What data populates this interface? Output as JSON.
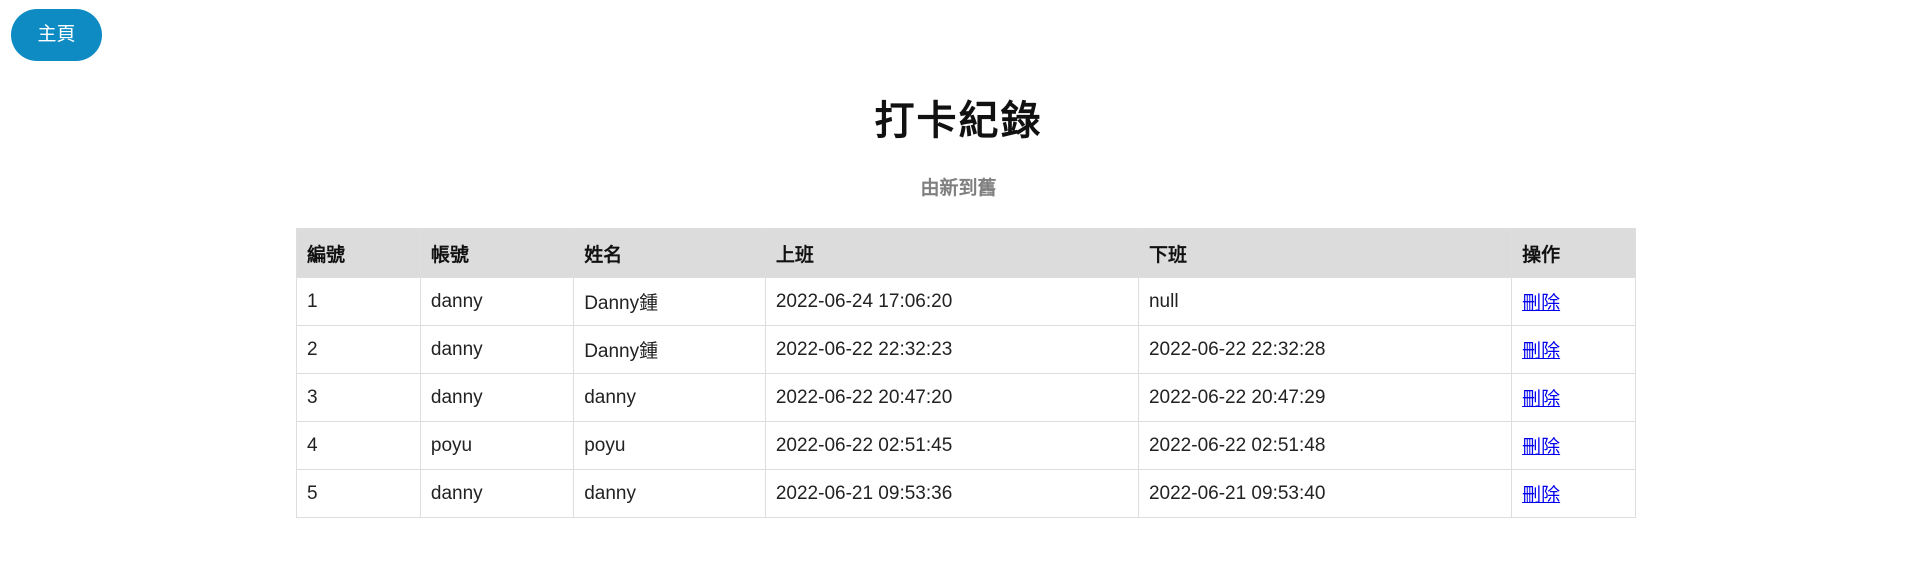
{
  "nav": {
    "home_label": "主頁"
  },
  "page": {
    "title": "打卡紀錄",
    "subtitle": "由新到舊"
  },
  "table": {
    "headers": [
      "編號",
      "帳號",
      "姓名",
      "上班",
      "下班",
      "操作"
    ],
    "rows": [
      {
        "id": "1",
        "account": "danny",
        "name": "Danny鍾",
        "clock_in": "2022-06-24 17:06:20",
        "clock_out": "null",
        "action": "刪除"
      },
      {
        "id": "2",
        "account": "danny",
        "name": "Danny鍾",
        "clock_in": "2022-06-22 22:32:23",
        "clock_out": "2022-06-22 22:32:28",
        "action": "刪除"
      },
      {
        "id": "3",
        "account": "danny",
        "name": "danny",
        "clock_in": "2022-06-22 20:47:20",
        "clock_out": "2022-06-22 20:47:29",
        "action": "刪除"
      },
      {
        "id": "4",
        "account": "poyu",
        "name": "poyu",
        "clock_in": "2022-06-22 02:51:45",
        "clock_out": "2022-06-22 02:51:48",
        "action": "刪除"
      },
      {
        "id": "5",
        "account": "danny",
        "name": "danny",
        "clock_in": "2022-06-21 09:53:36",
        "clock_out": "2022-06-21 09:53:40",
        "action": "刪除"
      }
    ]
  },
  "colors": {
    "home_button": "#0f8bc4",
    "header_bg": "#dcdcdc",
    "link": "#0000ee"
  }
}
